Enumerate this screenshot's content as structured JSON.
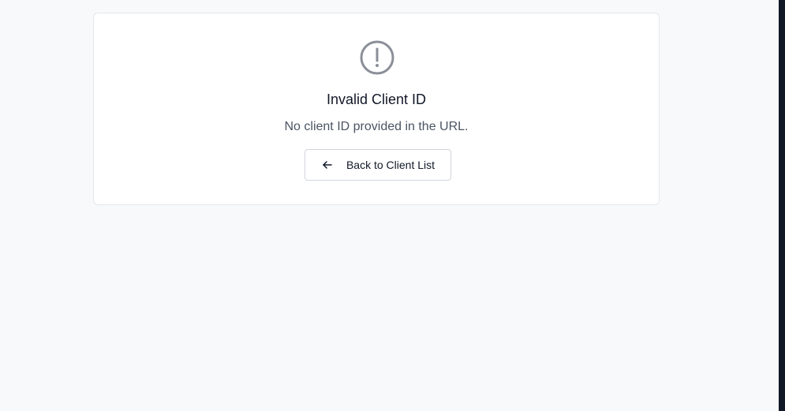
{
  "error_card": {
    "title": "Invalid Client ID",
    "message": "No client ID provided in the URL.",
    "icon": "alert-circle-icon"
  },
  "actions": {
    "back_label": "Back to Client List",
    "back_icon": "arrow-left-icon"
  },
  "colors": {
    "page_background": "#f8f9fa",
    "card_background": "#ffffff",
    "icon_color": "#8b8f98",
    "title_color": "#111827",
    "message_color": "#4b5563",
    "right_edge": "#111827"
  }
}
